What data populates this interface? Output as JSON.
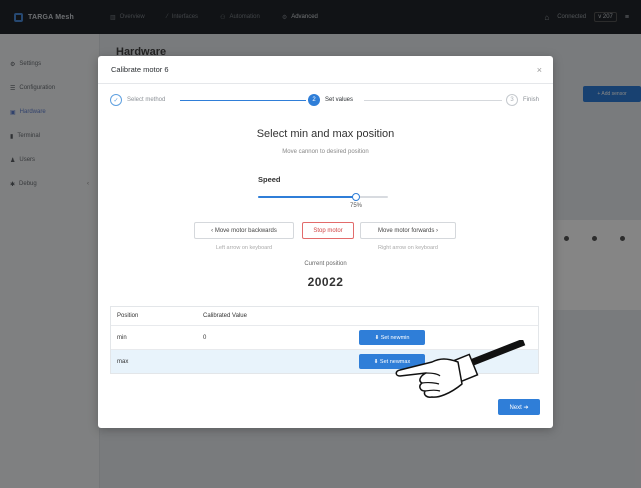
{
  "app": {
    "brand": "TARGA Mesh",
    "nav_tabs": [
      {
        "icon": "chart-icon",
        "label": "Overview",
        "active": false
      },
      {
        "icon": "wrench-icon",
        "label": "Interfaces",
        "active": false
      },
      {
        "icon": "automation-icon",
        "label": "Automation",
        "active": false
      },
      {
        "icon": "gear-icon",
        "label": "Advanced",
        "active": true
      }
    ],
    "right": {
      "connection": "Connected",
      "version": "v 207"
    }
  },
  "sidebar": {
    "items": [
      {
        "icon": "gear-icon",
        "label": "Settings",
        "active": false
      },
      {
        "icon": "sliders-icon",
        "label": "Configuration",
        "active": false
      },
      {
        "icon": "hardware-icon",
        "label": "Hardware",
        "active": true
      },
      {
        "icon": "terminal-icon",
        "label": "Terminal",
        "active": false
      },
      {
        "icon": "user-icon",
        "label": "Users",
        "active": false
      },
      {
        "icon": "bug-icon",
        "label": "Debug",
        "active": false,
        "chevron": "‹"
      }
    ]
  },
  "background": {
    "page_title": "Hardware",
    "add_button": "+ Add sensor"
  },
  "modal": {
    "title": "Calibrate motor 6",
    "close": "×",
    "steps": [
      {
        "number": "✓",
        "label": "Select method",
        "state": "done"
      },
      {
        "number": "2",
        "label": "Set values",
        "state": "active"
      },
      {
        "number": "3",
        "label": "Finish",
        "state": "future"
      }
    ],
    "section_title": "Select min and max position",
    "section_subtitle": "Move cannon to desired position",
    "speed": {
      "label": "Speed",
      "value": 75,
      "value_text": "75%"
    },
    "buttons": {
      "backward": "‹ Move motor backwards",
      "stop": "Stop motor",
      "forward": "Move motor forwards ›"
    },
    "hints": {
      "backward": "Left arrow on keyboard",
      "forward": "Right arrow on keyboard"
    },
    "current_position_label": "Current position",
    "current_position_value": "20022",
    "table": {
      "headers": {
        "position": "Position",
        "calibrated": "Calibrated Value"
      },
      "rows": [
        {
          "position": "min",
          "value": "0",
          "action": "⬇ Set newmin"
        },
        {
          "position": "max",
          "value": "",
          "action": "⬇ Set newmax"
        }
      ]
    },
    "next": "Next ➔"
  }
}
